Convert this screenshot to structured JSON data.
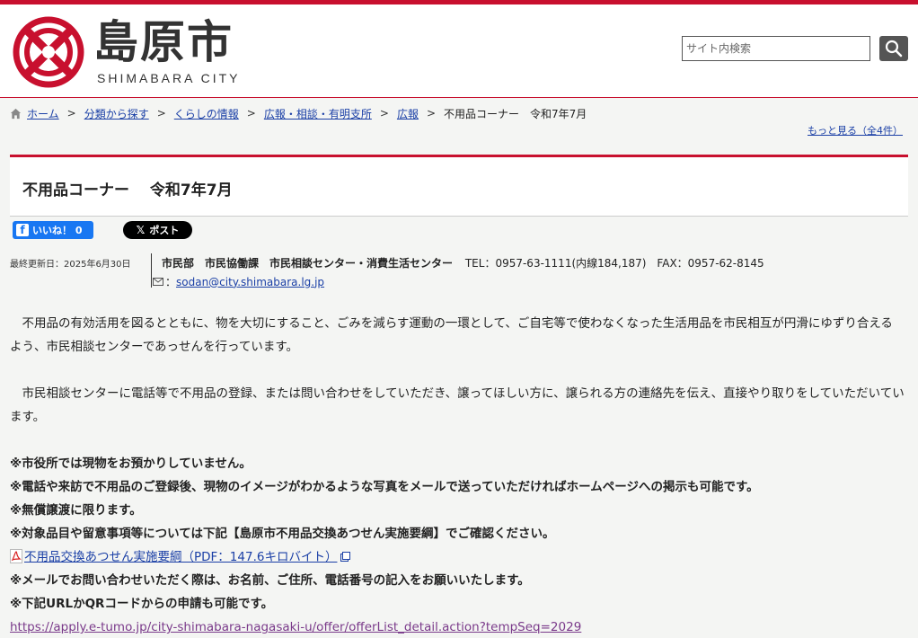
{
  "header": {
    "logo_ja": "島原市",
    "logo_en": "SHIMABARA CITY",
    "search_placeholder": "サイト内検索",
    "brand_color": "#c8102e"
  },
  "breadcrumb": {
    "items": [
      "ホーム",
      "分類から探す",
      "くらしの情報",
      "広報・相談・有明支所",
      "広報"
    ],
    "current": "不用品コーナー　令和7年7月",
    "more": "もっと見る（全4件）"
  },
  "page": {
    "title": "不用品コーナー　 令和7年7月"
  },
  "social": {
    "like": "いいね！ 0",
    "post": "ポスト"
  },
  "meta": {
    "updated": "最終更新日：2025年6月30日",
    "dept": "市民部　市民協働課　市民相談センター・消費生活センター",
    "tel": "TEL：0957-63-1111(内線184,187)　FAX：0957-62-8145",
    "email": "sodan@city.shimabara.lg.jp",
    "email_prefix": "："
  },
  "content": {
    "p1": "　不用品の有効活用を図るとともに、物を大切にすること、ごみを減らす運動の一環として、ご自宅等で使わなくなった生活用品を市民相互が円滑にゆずり合えるよう、市民相談センターであっせんを行っています。",
    "p2": "　市民相談センターに電話等で不用品の登録、または問い合わせをしていただき、譲ってほしい方に、譲られる方の連絡先を伝え、直接やり取りをしていただいています。",
    "n1": "※市役所では現物をお預かりしていません。",
    "n2": "※電話や来訪で不用品のご登録後、現物のイメージがわかるような写真をメールで送っていただければホームページへの掲示も可能です。",
    "n3": "※無償譲渡に限ります。",
    "n4": "※対象品目や留意事項等については下記【島原市不用品交換あつせん実施要綱】でご確認ください。",
    "pdf_link": "不用品交換あつせん実施要綱（PDF：147.6キロバイト）",
    "n5": "※メールでお問い合わせいただく際は、お名前、ご住所、電話番号の記入をお願いいたします。",
    "n6": "※下記URLかQRコードからの申請も可能です。",
    "url": "https://apply.e-tumo.jp/city-shimabara-nagasaki-u/offer/offerList_detail.action?tempSeq=2029"
  }
}
